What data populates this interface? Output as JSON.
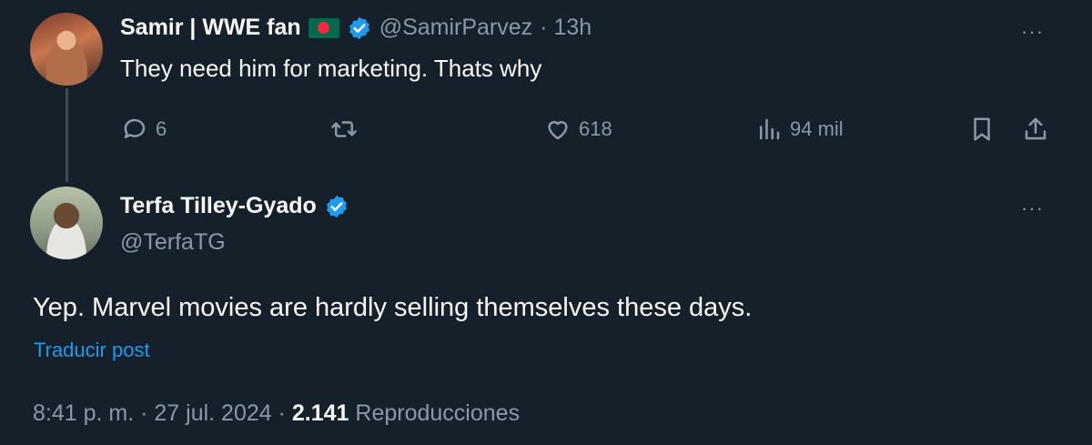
{
  "reply_parent": {
    "name": "Samir | WWE fan",
    "handle": "@SamirParvez",
    "time": "· 13h",
    "text": "They need him for marketing. Thats why",
    "actions": {
      "replies": "6",
      "likes": "618",
      "views": "94 mil"
    },
    "flag_icon": "bangladesh-flag-icon"
  },
  "main_post": {
    "name": "Terfa Tilley-Gyado",
    "handle": "@TerfaTG",
    "text": "Yep. Marvel movies are hardly selling themselves these days.",
    "translate": "Traducir post",
    "date": "8:41 p. m. · 27 jul. 2024 ·",
    "views_count": "2.141",
    "views_label": "Reproducciones"
  },
  "more_label": "···",
  "colors": {
    "background": "#15202b",
    "accent": "#1d9bf0",
    "secondary_text": "#8b98a5"
  }
}
